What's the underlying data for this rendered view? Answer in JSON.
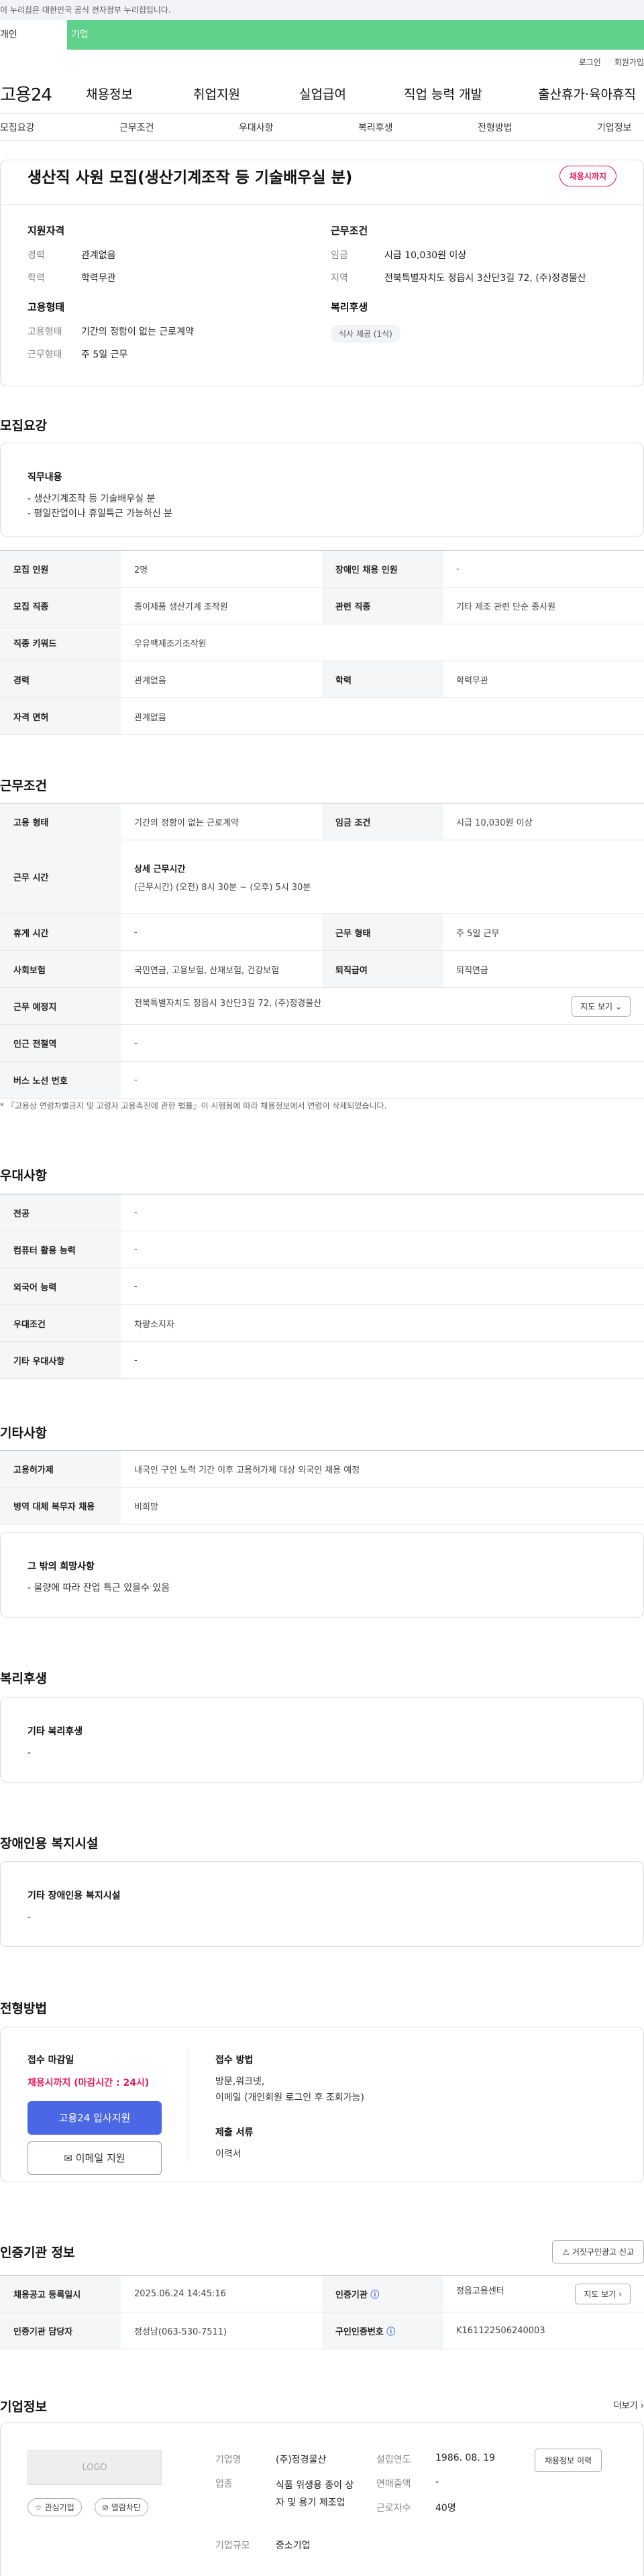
{
  "gov_banner": "이 누리집은 대한민국 공식 전자정부 누리집입니다.",
  "tabs": {
    "t1": "개인",
    "t2": "기업"
  },
  "util": {
    "login": "로그인",
    "join": "회원가입"
  },
  "gnb": {
    "logo": "고용24",
    "m1": "채용정보",
    "m2": "취업지원",
    "m3": "실업급여",
    "m4": "직업 능력 개발",
    "m5": "출산휴가·육아휴직"
  },
  "anchor": [
    "모집요강",
    "근무조건",
    "우대사항",
    "복리후생",
    "전형방법",
    "기업정보"
  ],
  "summary": {
    "title": "생산직 사원 모집(생산기계조작 등 기술배우실 분)",
    "badge": "채용시까지",
    "qual_title": "지원자격",
    "qual": [
      {
        "k": "경력",
        "v": "관계없음"
      },
      {
        "k": "학력",
        "v": "학력무관"
      }
    ],
    "work_title": "근무조건",
    "work": [
      {
        "k": "임금",
        "v": "시급 10,030원 이상"
      },
      {
        "k": "지역",
        "v": "전북특별자치도 정읍시 3산단3길 72, (주)정경물산"
      }
    ],
    "emp_title": "고용형태",
    "emp": [
      {
        "k": "고용형태",
        "v": "기간의 정함이 없는 근로계약"
      },
      {
        "k": "근무형태",
        "v": "주 5일 근무"
      }
    ],
    "wel_title": "복리후생",
    "wel_chip": "식사 제공 (1식)"
  },
  "recruit": {
    "title": "모집요강",
    "job_title": "직무내용",
    "job_lines": [
      "- 생산기계조작 등 기술배우실 분",
      "- 평일잔업이나 휴일특근 가능하신 분"
    ],
    "table": [
      [
        {
          "h": "모집 인원",
          "v": "2명"
        },
        {
          "h": "장애인 채용 인원",
          "v": "-"
        }
      ],
      [
        {
          "h": "모집 직종",
          "v": "종이제품 생산기계 조작원"
        },
        {
          "h": "관련 직종",
          "v": "기타 제조 관련 단순 종사원"
        }
      ],
      [
        {
          "h": "직종 키워드",
          "v": "우유팩제조기조작원"
        }
      ],
      [
        {
          "h": "경력",
          "v": "관계없음"
        },
        {
          "h": "학력",
          "v": "학력무관"
        }
      ],
      [
        {
          "h": "자격 면허",
          "v": "관계없음"
        }
      ]
    ]
  },
  "work": {
    "title": "근무조건",
    "r1": [
      {
        "h": "고용 형태",
        "v": "기간의 정함이 없는 근로계약"
      },
      {
        "h": "임금 조건",
        "v": "시급 10,030원 이상"
      }
    ],
    "hours_h": "근무 시간",
    "hours_sub": "상세 근무시간",
    "hours_v": "(근무시간) (오전) 8시 30분 ~ (오후) 5시 30분",
    "r3": [
      {
        "h": "휴게 시간",
        "v": "-"
      },
      {
        "h": "근무 형태",
        "v": "주 5일 근무"
      }
    ],
    "r4": [
      {
        "h": "사회보험",
        "v": "국민연금, 고용보험, 산재보험, 건강보험"
      },
      {
        "h": "퇴직급여",
        "v": "퇴직연금"
      }
    ],
    "loc_h": "근무 예정지",
    "loc_v": "전북특별자치도 정읍시 3산단3길 72, (주)정경물산",
    "map": "지도 보기",
    "sub_h": "인근 전철역",
    "sub_v": "-",
    "bus_h": "버스 노선 번호",
    "bus_v": "-",
    "note": "* 『고용상 연령차별금지 및 고령자 고용촉진에 관한 법률』이 시행됨에 따라 채용정보에서 연령이 삭제되었습니다."
  },
  "pref": {
    "title": "우대사항",
    "rows": [
      {
        "h": "전공",
        "v": "-"
      },
      {
        "h": "컴퓨터 활용 능력",
        "v": "-"
      },
      {
        "h": "외국어 능력",
        "v": "-"
      },
      {
        "h": "우대조건",
        "v": "차량소지자"
      },
      {
        "h": "기타 우대사항",
        "v": "-"
      }
    ]
  },
  "etc": {
    "title": "기타사항",
    "rows": [
      {
        "h": "고용허가제",
        "v": "내국인 구인 노력 기간 이후 고용허가제 대상 외국인 채용 예정"
      },
      {
        "h": "병역 대체 복무자 채용",
        "v": "비희망"
      }
    ],
    "box_title": "그 밖의 희망사항",
    "box_text": "- 물량에 따라 잔업 특근 있을수 있음"
  },
  "welfare": {
    "title": "복리후생",
    "box_title": "기타 복리후생",
    "box_text": "-"
  },
  "disab": {
    "title": "장애인용 복지시설",
    "box_title": "기타 장애인용 복지시설",
    "box_text": "-"
  },
  "method": {
    "title": "전형방법",
    "deadline_title": "접수 마감일",
    "deadline": "채용시까지 (마감시간 : 24시)",
    "apply": "고용24 입사지원",
    "email": "이메일 지원",
    "way_title": "접수 방법",
    "way_lines": [
      "방문,워크넷,",
      "이메일 (개인회원 로그인 후 조회가능)"
    ],
    "docs_title": "제출 서류",
    "docs": "이력서"
  },
  "cert": {
    "title": "인증기관 정보",
    "report": "거짓구인광고 신고",
    "r1": [
      {
        "h": "채용공고 등록일시",
        "v": "2025.06.24 14:45:16"
      },
      {
        "h": "인증기관",
        "v": "정읍고용센터"
      }
    ],
    "map": "지도 보기",
    "r2": [
      {
        "h": "인증기관 담당자",
        "v": "정성남(063-530-7511)"
      },
      {
        "h": "구인인증번호",
        "v": "K161122506240003"
      }
    ]
  },
  "company": {
    "title": "기업정보",
    "more": "더보기",
    "logo": "LOGO",
    "fav": "관심기업",
    "block": "열람차단",
    "name_k": "기업명",
    "name_v": "(주)정경물산",
    "ind_k": "업종",
    "ind_v": "식품 위생용 종이 상자 및 용기 제조업",
    "scale_k": "기업규모",
    "scale_v": "중소기업",
    "est_k": "설립연도",
    "est_v": "1986. 08. 19",
    "sales_k": "연매출액",
    "sales_v": "-",
    "staff_k": "근로자수",
    "staff_v": "40명",
    "hist": "채용정보 이력"
  }
}
